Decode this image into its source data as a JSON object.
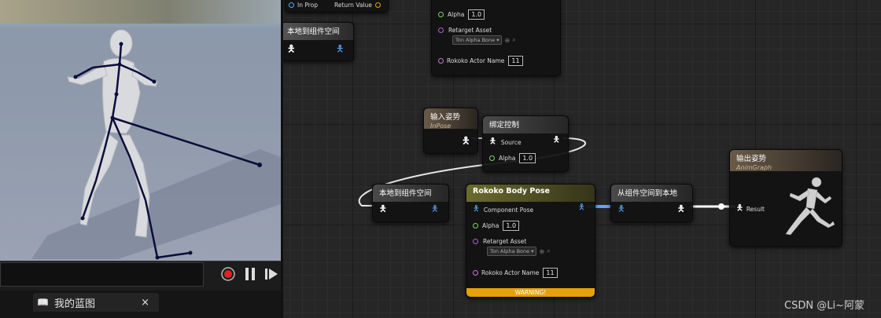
{
  "viewport": {
    "playback_buttons": [
      "record",
      "pause",
      "play"
    ]
  },
  "bottom_tab": {
    "icon": "book-icon",
    "label": "我的蓝图",
    "close": "×"
  },
  "graph": {
    "top_left_node": {
      "in_pin": "In Prop",
      "out_pin": "Return Value"
    },
    "local_to_component_top": {
      "title": "本地到组件空间"
    },
    "top_rokoko_node": {
      "alpha_label": "Alpha",
      "alpha_value": "1.0",
      "retarget_label": "Retarget Asset",
      "retarget_value": "Ton Alpha Bone",
      "actor_name_label": "Rokoko Actor Name",
      "actor_name_value": "11"
    },
    "input_pose": {
      "title": "输入姿势",
      "subtitle": "InPose"
    },
    "bind_control": {
      "title": "绑定控制",
      "source_label": "Source",
      "alpha_label": "Alpha",
      "alpha_value": "1.0"
    },
    "local_to_component": {
      "title": "本地到组件空间"
    },
    "rokoko_body_pose": {
      "title": "Rokoko Body Pose",
      "component_pose_label": "Component Pose",
      "alpha_label": "Alpha",
      "alpha_value": "1.0",
      "retarget_label": "Retarget Asset",
      "retarget_value": "Ton Alpha Bone",
      "actor_name_label": "Rokoko Actor Name",
      "actor_name_value": "11",
      "warning": "WARNING!"
    },
    "component_to_local": {
      "title": "从组件空间到本地"
    },
    "output_pose": {
      "title": "输出姿势",
      "subtitle": "AnimGraph",
      "result_label": "Result"
    }
  },
  "watermark": "CSDN @Li~阿蒙",
  "colors": {
    "rokoko_header": "#6b6b2e",
    "pose_header": "#6a5a48",
    "plain_header": "#4a4a4a",
    "pin_blue": "#5aa9ff",
    "pin_green": "#7fd36a",
    "pin_purple": "#b060d0",
    "warning": "#e4a10c"
  }
}
